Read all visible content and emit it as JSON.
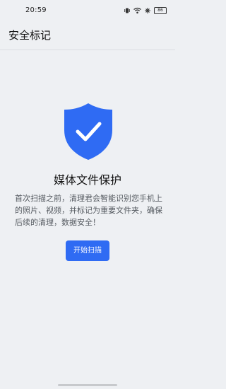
{
  "status_bar": {
    "time": "20:59",
    "battery": "86",
    "icons": [
      "vibrate-icon",
      "wifi-icon",
      "bluetooth-icon",
      "battery-icon"
    ]
  },
  "app_bar": {
    "title": "安全标记"
  },
  "main": {
    "shield_icon": "shield-check-icon",
    "shield_color": "#2f6bf3",
    "heading": "媒体文件保护",
    "description": "首次扫描之前，清理君会智能识别您手机上的照片、视频，并标记为重要文件夹，确保后续的清理，数据安全！",
    "start_button": "开始扫描"
  },
  "colors": {
    "accent": "#2f6bf3",
    "background": "#eef0f3"
  }
}
